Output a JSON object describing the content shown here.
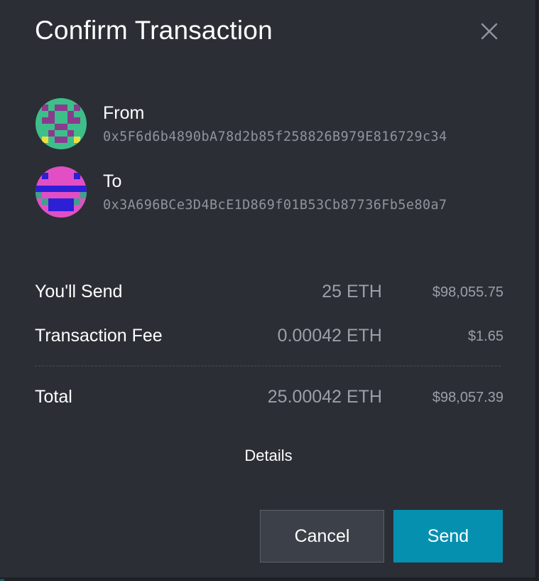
{
  "dialog": {
    "title": "Confirm Transaction",
    "close_icon": "close-icon"
  },
  "from": {
    "label": "From",
    "address": "0x5F6d6b4890bA78d2b85f258826B979E816729c34",
    "avatar_colors": [
      "#3dbf8a",
      "#8b3b8f",
      "#e6e045"
    ]
  },
  "to": {
    "label": "To",
    "address": "0x3A696BCe3D4BcE1D869f01B53Cb87736Fb5e80a7",
    "avatar_colors": [
      "#e24fc5",
      "#2c1fd6",
      "#3fa18a"
    ]
  },
  "summary": {
    "send": {
      "label": "You'll Send",
      "eth": "25 ETH",
      "usd": "$98,055.75"
    },
    "fee": {
      "label": "Transaction Fee",
      "eth": "0.00042 ETH",
      "usd": "$1.65"
    },
    "total": {
      "label": "Total",
      "eth": "25.00042 ETH",
      "usd": "$98,057.39"
    }
  },
  "details_label": "Details",
  "buttons": {
    "cancel": "Cancel",
    "send": "Send"
  },
  "colors": {
    "background": "#2b2e35",
    "primary": "#0690b0",
    "secondary_button": "#3c4049",
    "muted_text": "#9aa0a8"
  }
}
